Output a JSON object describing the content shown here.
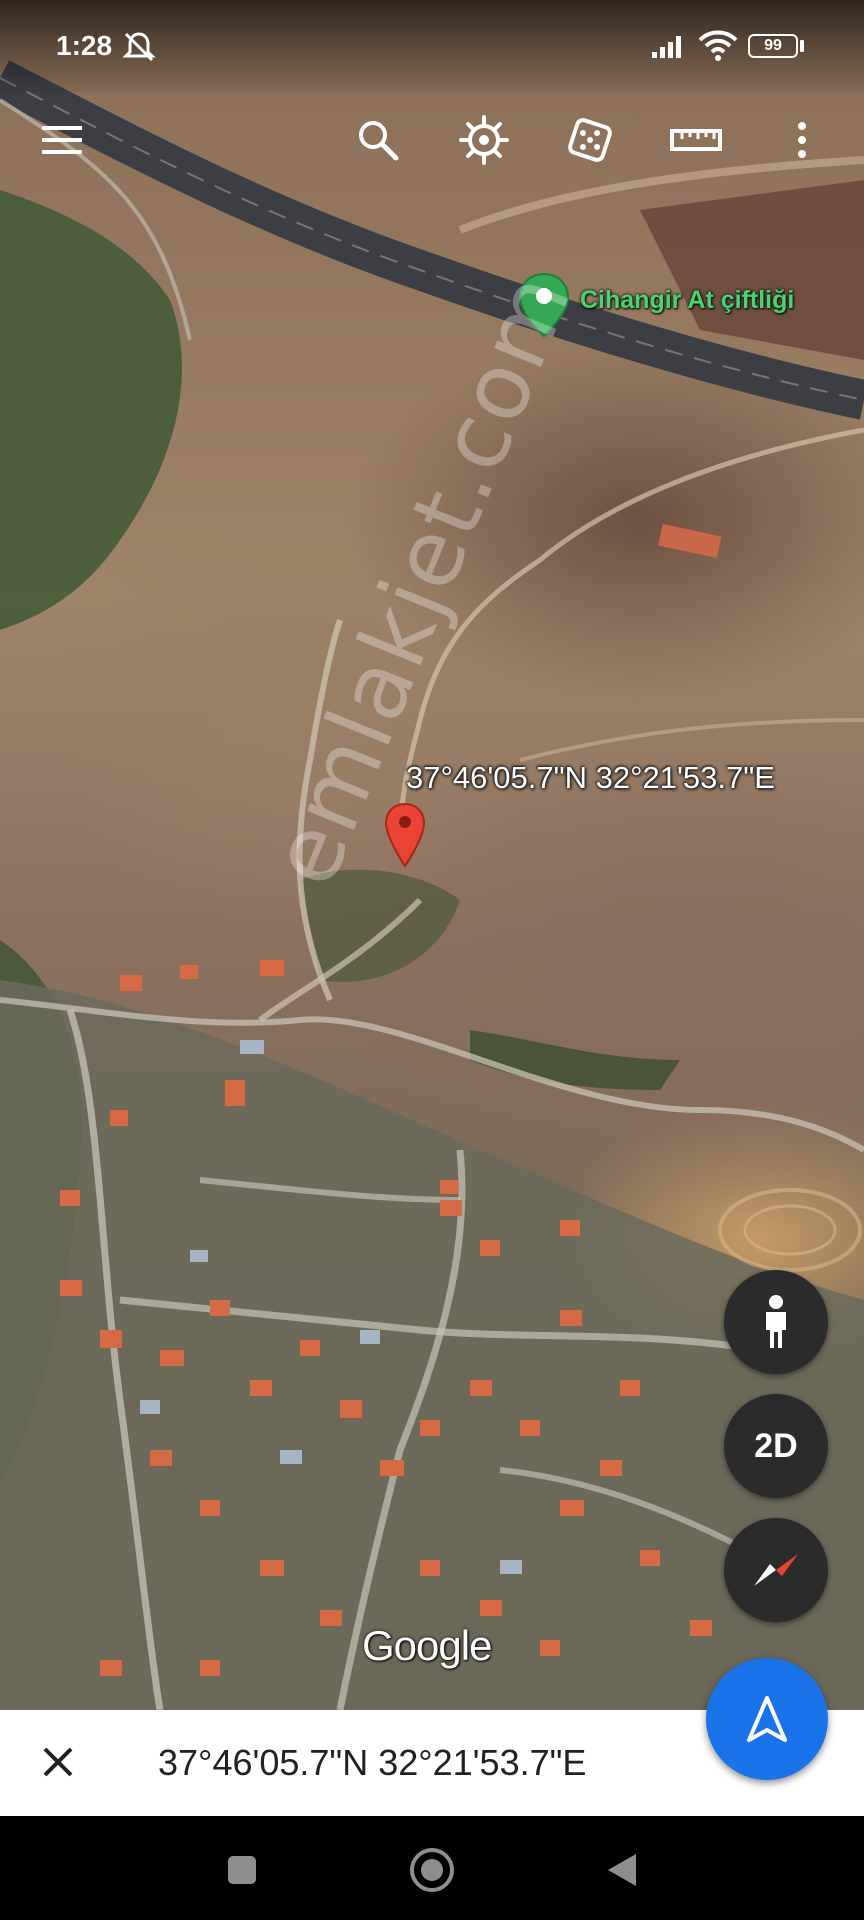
{
  "status_bar": {
    "time": "1:28",
    "battery": "99",
    "icons": [
      "notification-off-icon",
      "signal-icon",
      "wifi-icon",
      "battery-icon"
    ]
  },
  "toolbar": {
    "buttons": [
      "menu-icon",
      "search-icon",
      "voyager-icon",
      "random-dice-icon",
      "measure-ruler-icon",
      "more-vert-icon"
    ]
  },
  "map": {
    "place_label": "Cihangir At çiftliği",
    "pin_coordinates": "37°46'05.7\"N 32°21'53.7\"E",
    "watermark": "emlakjet.com",
    "attribution": "Google",
    "colors": {
      "place_pin": "#34a853",
      "dropped_pin": "#ea4335",
      "fab": "#1a73e8"
    }
  },
  "controls": {
    "view_mode_label": "2D",
    "pegman": "pegman-icon",
    "compass": "compass-icon",
    "navigate": "navigation-arrow-icon"
  },
  "info_panel": {
    "coordinates": "37°46'05.7\"N 32°21'53.7\"E"
  },
  "nav_bar": {
    "buttons": [
      "recents-square-icon",
      "home-circle-icon",
      "back-triangle-icon"
    ]
  }
}
